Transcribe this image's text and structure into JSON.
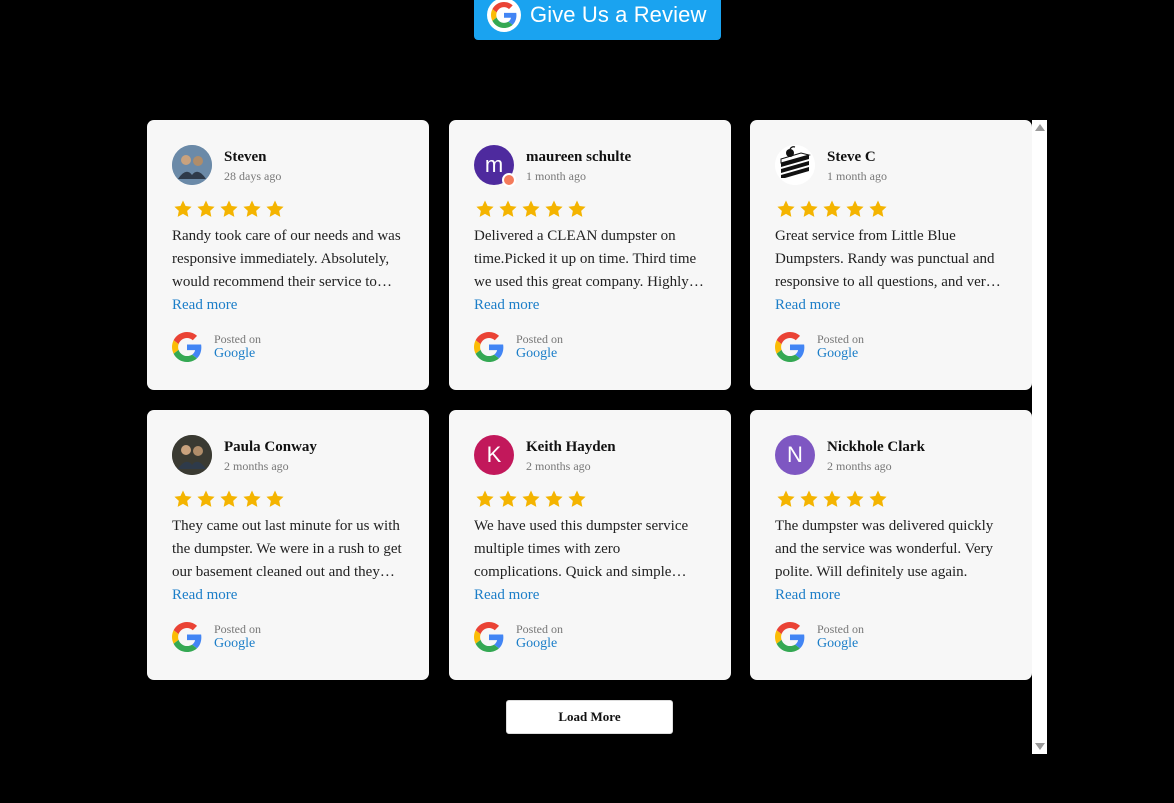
{
  "header": {
    "review_button_label": "Give Us a Review"
  },
  "reviews": [
    {
      "name": "Steven",
      "time": "28 days ago",
      "avatar_type": "photo",
      "avatar_color": "#6b8aa8",
      "rating": 5,
      "text": "Randy took care of our needs and was responsive immediately. Absolutely, would recommend their service to anyone needing a dumpster.",
      "read_more": "Read more",
      "posted_on": "Posted on",
      "source": "Google"
    },
    {
      "name": "maureen schulte",
      "time": "1 month ago",
      "avatar_type": "letter",
      "avatar_letter": "m",
      "avatar_color": "#4e2a9e",
      "avatar_badge": true,
      "rating": 5,
      "text": "Delivered a CLEAN dumpster on time.Picked it up on time. Third time we used this great company. Highly recommend.",
      "read_more": "Read more",
      "posted_on": "Posted on",
      "source": "Google"
    },
    {
      "name": "Steve C",
      "time": "1 month ago",
      "avatar_type": "cake",
      "avatar_color": "#ffffff",
      "rating": 5,
      "text": "Great service from Little Blue Dumpsters. Randy was punctual and responsive to all questions, and very helpful.",
      "read_more": "Read more",
      "posted_on": "Posted on",
      "source": "Google"
    },
    {
      "name": "Paula Conway",
      "time": "2 months ago",
      "avatar_type": "photo",
      "avatar_color": "#3a3a32",
      "rating": 5,
      "text": "They came out last minute for us with the dumpster. We were in a rush to get our basement cleaned out and they made it easy.",
      "read_more": "Read more",
      "posted_on": "Posted on",
      "source": "Google"
    },
    {
      "name": "Keith Hayden",
      "time": "2 months ago",
      "avatar_type": "letter",
      "avatar_letter": "K",
      "avatar_color": "#c2185b",
      "rating": 5,
      "text": "We have used this dumpster service multiple times with zero complications. Quick and simple every single time.",
      "read_more": "Read more",
      "posted_on": "Posted on",
      "source": "Google"
    },
    {
      "name": "Nickhole Clark",
      "time": "2 months ago",
      "avatar_type": "letter",
      "avatar_letter": "N",
      "avatar_color": "#7e57c2",
      "rating": 5,
      "text": "The dumpster was delivered quickly and the service was wonderful. Very polite. Will definitely use again.",
      "read_more": "Read more",
      "posted_on": "Posted on",
      "source": "Google"
    }
  ],
  "load_more_label": "Load More",
  "colors": {
    "accent": "#1aa3f0",
    "link": "#1c7ec8",
    "star": "#f4b400",
    "card_bg": "#f7f7f7",
    "page_bg": "#000000"
  }
}
